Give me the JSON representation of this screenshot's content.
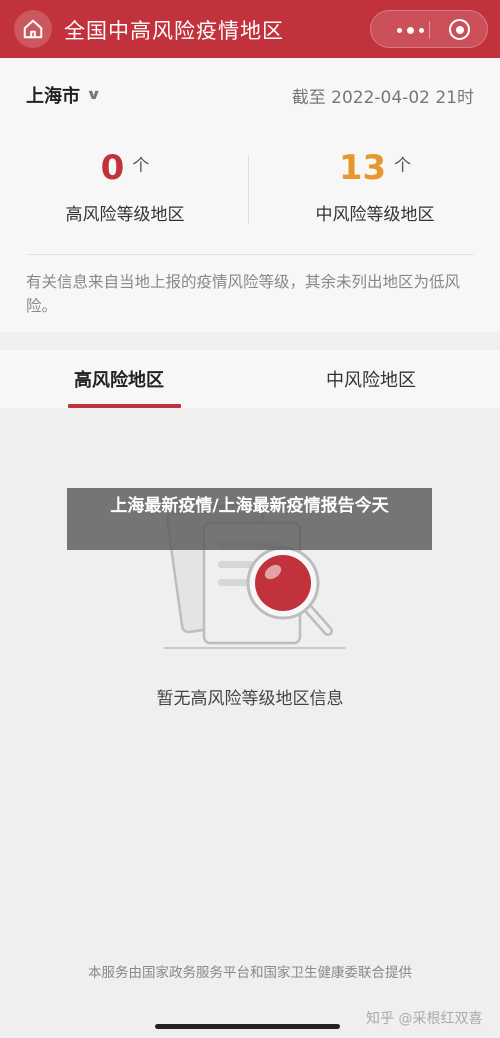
{
  "header": {
    "title": "全国中高风险疫情地区",
    "home_icon": "home-icon",
    "more_icon": "more-dots-icon",
    "close_icon": "target-circle-icon",
    "color": "#c2323c"
  },
  "summary": {
    "city": "上海市",
    "as_of": "截至 2022-04-02 21时",
    "high_risk": {
      "count": "0",
      "unit": "个",
      "label": "高风险等级地区",
      "color": "#c2323c"
    },
    "mid_risk": {
      "count": "13",
      "unit": "个",
      "label": "中风险等级地区",
      "color": "#e8972e"
    },
    "notice": "有关信息来自当地上报的疫情风险等级，其余未列出地区为低风险。"
  },
  "tabs": [
    {
      "label": "高风险地区",
      "active": true
    },
    {
      "label": "中风险地区",
      "active": false
    }
  ],
  "empty_state": {
    "text": "暂无高风险等级地区信息",
    "icon": "document-magnifier-icon"
  },
  "overlay": {
    "text": "上海最新疫情/上海最新疫情报告今天"
  },
  "footer": {
    "note": "本服务由国家政务服务平台和国家卫生健康委联合提供",
    "watermark": "知乎 @采根红双喜"
  }
}
